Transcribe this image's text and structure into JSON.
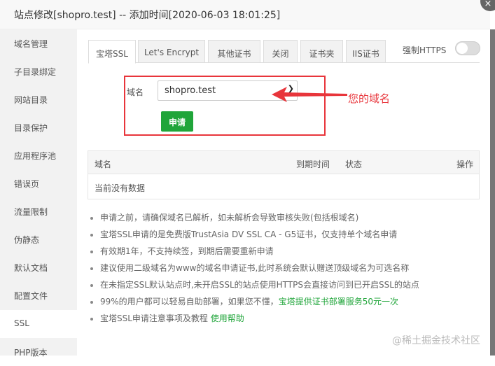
{
  "title": "站点修改[shopro.test] -- 添加时间[2020-06-03 18:01:25]",
  "close_icon": "×",
  "sidebar": [
    "域名管理",
    "子目录绑定",
    "网站目录",
    "目录保护",
    "应用程序池",
    "错误页",
    "流量限制",
    "伪静态",
    "默认文档",
    "配置文件",
    "SSL",
    "PHP版本"
  ],
  "sidebar_active": "SSL",
  "tabs": [
    "宝塔SSL",
    "Let's Encrypt",
    "其他证书",
    "关闭",
    "证书夹",
    "IIS证书"
  ],
  "force_https_label": "强制HTTPS",
  "force_https_on": false,
  "form": {
    "label": "域名",
    "value": "shopro.test",
    "submit": "申请"
  },
  "annotation": "您的域名",
  "annotation_color": "#e8353b",
  "table": {
    "headers": [
      "域名",
      "到期时间",
      "状态",
      "操作"
    ],
    "empty": "当前没有数据"
  },
  "notes": [
    {
      "text": "申请之前，请确保域名已解析，如未解析会导致审核失败(包括根域名)"
    },
    {
      "text": "宝塔SSL申请的是免费版TrustAsia DV SSL CA - G5证书，仅支持单个域名申请"
    },
    {
      "text": "有效期1年，不支持续签，到期后需要重新申请"
    },
    {
      "text": "建议使用二级域名为www的域名申请证书,此时系统会默认赠送顶级域名为可选名称"
    },
    {
      "text": "在未指定SSL默认站点时,未开启SSL的站点使用HTTPS会直接访问到已开启SSL的站点"
    },
    {
      "text": "99%的用户都可以轻易自助部署，如果您不懂，",
      "link": "宝塔提供证书部署服务50元一次"
    },
    {
      "text": "宝塔SSL申请注意事项及教程 ",
      "link": "使用帮助"
    }
  ],
  "accent": "#20a53a",
  "watermark": "@稀土掘金技术社区"
}
